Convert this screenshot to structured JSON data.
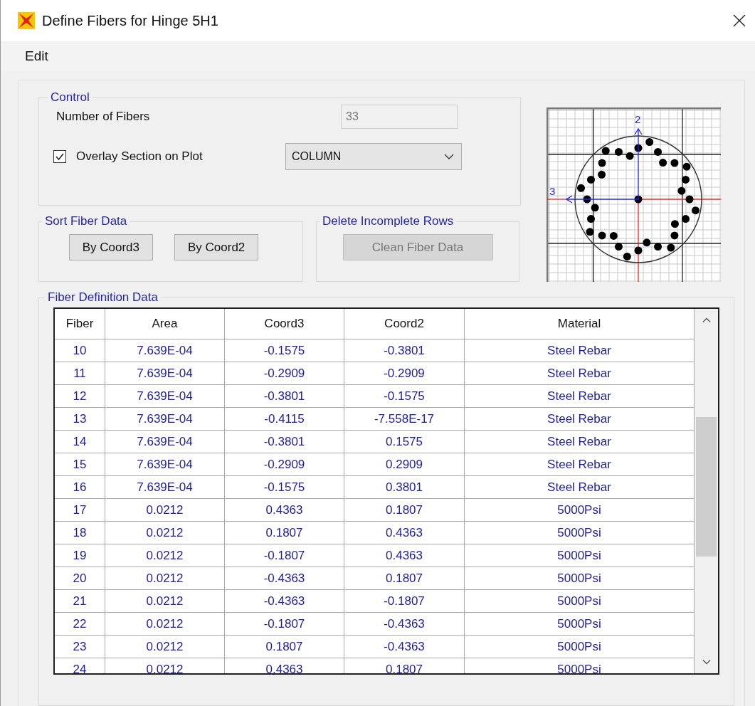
{
  "window": {
    "title": "Define Fibers for Hinge 5H1"
  },
  "menu": [
    "Edit"
  ],
  "control": {
    "title": "Control",
    "fibers_label": "Number of Fibers",
    "fibers_value": "33",
    "overlay": {
      "label": "Overlay Section on Plot",
      "checked": true
    },
    "section": "COLUMN"
  },
  "sort": {
    "title": "Sort Fiber Data",
    "buttons": [
      {
        "label": "By Coord3",
        "disabled": false
      },
      {
        "label": "By Coord2",
        "disabled": false
      }
    ]
  },
  "delete": {
    "title": "Delete Incomplete Rows",
    "buttons": [
      {
        "label": "Clean Fiber Data",
        "disabled": true
      }
    ]
  },
  "plot": {
    "axis_labels": [
      "2",
      "3"
    ]
  },
  "table": {
    "title": "Fiber Definition Data",
    "columns": [
      "Fiber",
      "Area",
      "Coord3",
      "Coord2",
      "Material"
    ],
    "rows": [
      [
        "10",
        "7.639E-04",
        "-0.1575",
        "-0.3801",
        "Steel Rebar"
      ],
      [
        "11",
        "7.639E-04",
        "-0.2909",
        "-0.2909",
        "Steel Rebar"
      ],
      [
        "12",
        "7.639E-04",
        "-0.3801",
        "-0.1575",
        "Steel Rebar"
      ],
      [
        "13",
        "7.639E-04",
        "-0.4115",
        "-7.558E-17",
        "Steel Rebar"
      ],
      [
        "14",
        "7.639E-04",
        "-0.3801",
        "0.1575",
        "Steel Rebar"
      ],
      [
        "15",
        "7.639E-04",
        "-0.2909",
        "0.2909",
        "Steel Rebar"
      ],
      [
        "16",
        "7.639E-04",
        "-0.1575",
        "0.3801",
        "Steel Rebar"
      ],
      [
        "17",
        "0.0212",
        "0.4363",
        "0.1807",
        "5000Psi"
      ],
      [
        "18",
        "0.0212",
        "0.1807",
        "0.4363",
        "5000Psi"
      ],
      [
        "19",
        "0.0212",
        "-0.1807",
        "0.4363",
        "5000Psi"
      ],
      [
        "20",
        "0.0212",
        "-0.4363",
        "0.1807",
        "5000Psi"
      ],
      [
        "21",
        "0.0212",
        "-0.4363",
        "-0.1807",
        "5000Psi"
      ],
      [
        "22",
        "0.0212",
        "-0.1807",
        "-0.4363",
        "5000Psi"
      ],
      [
        "23",
        "0.0212",
        "0.1807",
        "-0.4363",
        "5000Psi"
      ],
      [
        "24",
        "0.0212",
        "0.4363",
        "0.1807",
        "5000Psi"
      ]
    ]
  }
}
